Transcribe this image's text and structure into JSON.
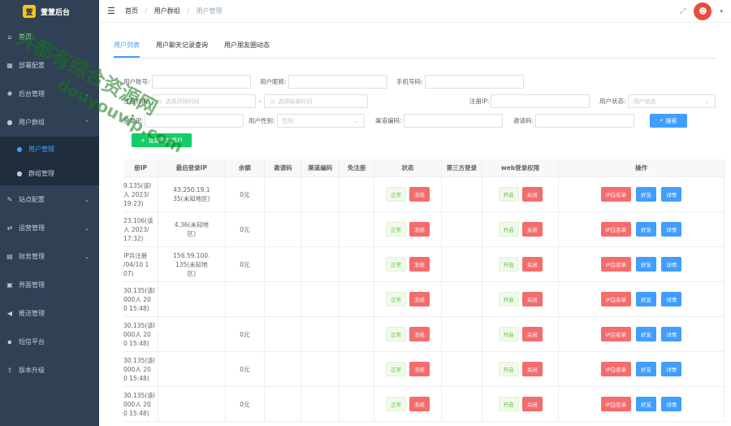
{
  "app": {
    "title": "萱萱后台",
    "logo": "萱"
  },
  "sidebar": {
    "items": [
      {
        "label": "首页",
        "icon": "home-icon",
        "glyph": "⌂"
      },
      {
        "label": "部署配置",
        "icon": "grid-icon",
        "glyph": "▦"
      },
      {
        "label": "后台管理",
        "icon": "gear-icon",
        "glyph": "✺",
        "chev": "⌄"
      },
      {
        "label": "用户群组",
        "icon": "user-icon",
        "glyph": "●",
        "chev": "⌃"
      }
    ],
    "sub": [
      {
        "label": "用户管理",
        "glyph": "●"
      },
      {
        "label": "群组管理",
        "glyph": "●"
      }
    ],
    "items2": [
      {
        "label": "站点配置",
        "glyph": "✎",
        "chev": "⌄"
      },
      {
        "label": "运营管理",
        "glyph": "⇄",
        "chev": "⌄"
      },
      {
        "label": "财务管理",
        "glyph": "▤",
        "chev": "⌄"
      },
      {
        "label": "界面管理",
        "glyph": "▣"
      },
      {
        "label": "推送管理",
        "glyph": "◀"
      },
      {
        "label": "短信平台",
        "glyph": "▪"
      },
      {
        "label": "版本升级",
        "glyph": "⇪"
      }
    ]
  },
  "navbar": {
    "hamburger": "☰",
    "breadcrumb": [
      "首页",
      "用户群组",
      "用户管理"
    ],
    "sep": "/",
    "avatar": "☻",
    "caret": "▾",
    "fullscreen": "⤢"
  },
  "tabs": [
    "用户列表",
    "用户聊天记录查询",
    "用户朋友圈动态"
  ],
  "form": {
    "account_label": "用户账号:",
    "nickname_label": "用户昵称:",
    "phone_label": "手机号码:",
    "reg_time_label": "注册时间:",
    "start_ph": "选择开始时间",
    "range_sep": "-",
    "end_ph": "选择结束时间",
    "reg_ip_label": "注册IP:",
    "status_label": "用户状态:",
    "status_ph": "用户状态",
    "login_ip_label": "登录IP:",
    "gender_label": "用户性别:",
    "gender_ph": "性别",
    "channel_label": "渠道编码:",
    "invite_label": "邀请码:",
    "search_btn": "搜索",
    "add_btn": "批量添加用户",
    "search_icon": "⌕",
    "plus_icon": "+",
    "cal_icon": "◷",
    "select_icon": "⌄"
  },
  "table": {
    "headers": [
      "册IP",
      "最后登录IP",
      "余额",
      "邀请码",
      "渠道编码",
      "免注册",
      "状态",
      "第三方登录",
      "web登录权限",
      "操作"
    ],
    "rows": [
      {
        "reg": [
          "9.135(该I",
          "人 2023/",
          "19:23)"
        ],
        "last": [
          "43.250.19.1",
          "35(未知地区)"
        ],
        "balance": "0元"
      },
      {
        "reg": [
          "23.106(该",
          "人 2023/",
          "17:32)"
        ],
        "last": [
          "4.36(未知地",
          "区)"
        ],
        "balance": "0元"
      },
      {
        "reg": [
          "IP共注册",
          "/04/10 1",
          "07)"
        ],
        "last": [
          "156.59.100.",
          "135(未知地",
          "区)"
        ],
        "balance": "0元"
      },
      {
        "reg": [
          "30.135(该I",
          "000人 20",
          "0 15:48)"
        ],
        "last": [],
        "balance": ""
      },
      {
        "reg": [
          "30.135(该I",
          "000人 20",
          "0 15:48)"
        ],
        "last": [],
        "balance": "0元"
      },
      {
        "reg": [
          "30.135(该I",
          "000人 20",
          "0 15:48)"
        ],
        "last": [],
        "balance": "0元"
      },
      {
        "reg": [
          "30.135(该I",
          "000人 20",
          "0 15:48)"
        ],
        "last": [],
        "balance": "0元"
      }
    ],
    "status_normal": "正常",
    "status_freeze": "冻结",
    "web_on": "开启",
    "web_off": "关闭",
    "act_whitelist": "IP白名单",
    "act_friend": "好友",
    "act_detail": "详情"
  },
  "watermark": {
    "line1": "共都有综合资源网",
    "line2": "douyouvip.com"
  },
  "colors": {
    "sidebar_bg": "#304156",
    "primary": "#409eff",
    "danger": "#f56c6c",
    "success": "#67c23a"
  }
}
